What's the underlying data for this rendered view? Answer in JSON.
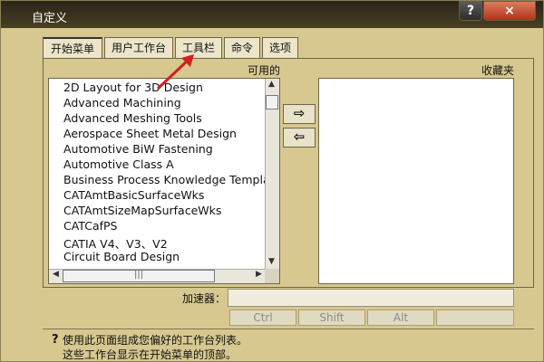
{
  "window": {
    "title": "自定义",
    "help": "?",
    "close": "×"
  },
  "tabs": [
    {
      "label": "开始菜单",
      "active": true
    },
    {
      "label": "用户工作台"
    },
    {
      "label": "工具栏"
    },
    {
      "label": "命令"
    },
    {
      "label": "选项"
    }
  ],
  "available": {
    "title": "可用的",
    "items": [
      "2D Layout for 3D Design",
      "Advanced Machining",
      "Advanced Meshing Tools",
      "Aerospace Sheet Metal  Design",
      "Automotive BiW Fastening",
      "Automotive Class A",
      "Business Process Knowledge Template",
      "CATAmtBasicSurfaceWks",
      "CATAmtSizeMapSurfaceWks",
      "CATCafPS",
      "CATIA V4、V3、V2",
      "Circuit Board Design"
    ]
  },
  "favorites": {
    "title": "收藏夹"
  },
  "move_buttons": {
    "add": "⇨",
    "remove": "⇦"
  },
  "accelerator": {
    "label": "加速器：",
    "value": ""
  },
  "modifiers": [
    "Ctrl",
    "Shift",
    "Alt"
  ],
  "help": {
    "icon": "?",
    "line1": "使用此页面组成您偏好的工作台列表。",
    "line2": "这些工作台显示在开始菜单的顶部。"
  },
  "colors": {
    "dialog_bg": "#d6c88f",
    "annotation_arrow": "#d11f1f"
  }
}
